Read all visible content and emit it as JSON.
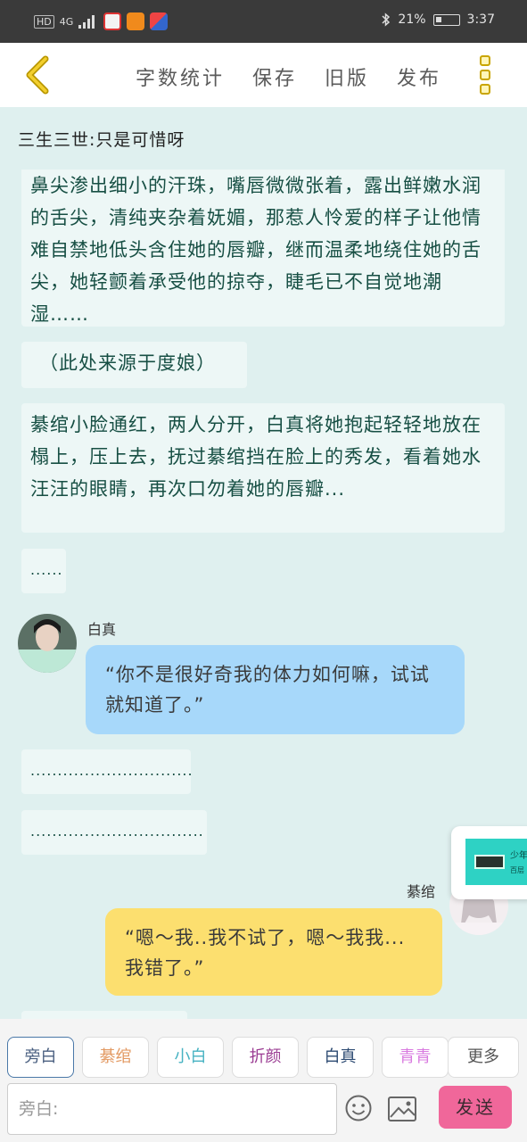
{
  "status_bar": {
    "hd": "HD",
    "network": "4G",
    "battery": "21%",
    "time": "3:37"
  },
  "header": {
    "menu": [
      "字数统计",
      "保存",
      "旧版",
      "发布"
    ],
    "icons": {
      "back": "chevron-left-icon",
      "more": "more-vertical-icon"
    },
    "accent_color": "#e2b900"
  },
  "chat": {
    "chapter_title": "三生三世:只是可惜呀",
    "narration_1": "下，看到她眼眶里萦绕薄薄的浮雾，脸上泛了红潮，鼻尖渗出细小的汗珠，嘴唇微微张着，露出鲜嫩水润的舌尖，清纯夹杂着妩媚，那惹人怜爱的样子让他情难自禁地低头含住她的唇瓣，继而温柔地绕住她的舌尖，她轻颤着承受他的掠夺，睫毛已不自觉地潮湿……",
    "narration_2": "（此处来源于度娘）",
    "narration_3": "綦绾小脸通红，两人分开，白真将她抱起轻轻地放在榻上，压上去，抚过綦绾挡在脸上的秀发，看着她水汪汪的眼睛，再次口勿着她的唇瓣...",
    "narration_4": "......",
    "msg1": {
      "speaker": "白真",
      "text": "“你不是很好奇我的体力如何嘛，试试就知道了。”",
      "color": "#a7d8fa"
    },
    "narration_5": "..............................",
    "narration_6": "................................",
    "msg2": {
      "speaker": "綦绾",
      "text": "“嗯～我..我不试了，嗯～我我...我错了。”",
      "color": "#fcdf6f"
    }
  },
  "float_card": {
    "line1": "少年",
    "line2": "百层"
  },
  "bottom": {
    "roles": [
      {
        "label": "旁白",
        "color": "#4a5f80"
      },
      {
        "label": "綦绾",
        "color": "#e39a63"
      },
      {
        "label": "小白",
        "color": "#46b2c2"
      },
      {
        "label": "折颜",
        "color": "#9a3b92"
      },
      {
        "label": "白真",
        "color": "#2c4a72"
      },
      {
        "label": "青青",
        "color": "#d97be0"
      },
      {
        "label": "更多",
        "color": "#555555"
      }
    ],
    "input_placeholder": "旁白:",
    "send_label": "发送",
    "send_color": "#f0679a"
  }
}
